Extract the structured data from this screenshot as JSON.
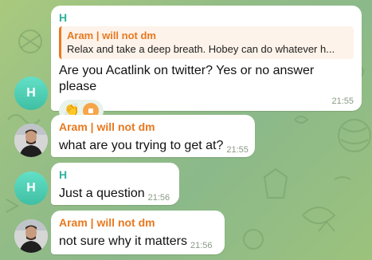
{
  "messages": [
    {
      "sender": "H",
      "reply": {
        "author": "Aram | will not dm",
        "text": "Relax and take a deep breath. Hobey can do whatever h..."
      },
      "text": "Are you Acatlink on twitter? Yes or no answer please",
      "reaction_emoji": "👏",
      "time": "21:55"
    },
    {
      "sender": "Aram | will not dm",
      "text": "what are you trying to get at?",
      "time": "21:55"
    },
    {
      "sender": "H",
      "text": "Just a question",
      "time": "21:56"
    },
    {
      "sender": "Aram | will not dm",
      "text": "not sure why it matters",
      "time": "21:56"
    }
  ],
  "avatar_letter": "H",
  "colors": {
    "accent_teal": "#2fb39d",
    "accent_orange": "#e8791f",
    "bubble": "#ffffff",
    "background": "#9cc27c"
  }
}
